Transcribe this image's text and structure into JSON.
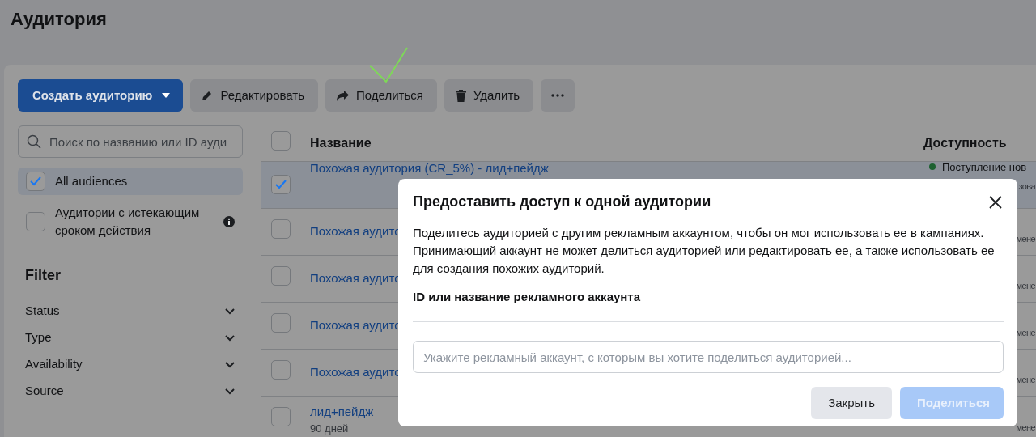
{
  "page": {
    "title": "Аудитория"
  },
  "toolbar": [
    {
      "kind": "create",
      "label": "Создать аудиторию"
    },
    {
      "kind": "edit",
      "label": "Редактировать"
    },
    {
      "kind": "share",
      "label": "Поделиться"
    },
    {
      "kind": "delete",
      "label": "Удалить"
    },
    {
      "kind": "more"
    }
  ],
  "sidebar": {
    "search": {
      "placeholder": "Поиск по названию или ID ауди"
    },
    "audience_sets": [
      {
        "label": "All audiences",
        "checked": true,
        "info": false
      },
      {
        "label": "Аудитории с истекающим сроком действия",
        "checked": false,
        "info": true
      }
    ],
    "filter": {
      "title": "Filter",
      "items": [
        {
          "label": "Status",
          "expanded": false
        },
        {
          "label": "Type",
          "expanded": false
        },
        {
          "label": "Availability",
          "expanded": false
        },
        {
          "label": "Source",
          "expanded": false
        }
      ]
    }
  },
  "table": {
    "select_all": {
      "checked": false
    },
    "columns": [
      "Название",
      "Доступность"
    ],
    "rows": [
      {
        "name": "Похожая аудитория (CR_5%) - лид+пейдж",
        "checked": true,
        "availability": "Поступление нов",
        "color": "#1d6130",
        "availability_detail": "зова"
      },
      {
        "name": "Похожая аудито",
        "checked": false,
        "availability_detail": "мене"
      },
      {
        "name": "Похожая аудито",
        "checked": false,
        "availability_detail": "мене"
      },
      {
        "name": "Похожая аудито",
        "checked": false,
        "availability_detail": "мене"
      },
      {
        "name": "Похожая аудито",
        "checked": false,
        "availability_detail": "мене"
      },
      {
        "name": "лид+пейдж",
        "subtitle": "90 дней",
        "checked": false,
        "availability_detail": "мене"
      }
    ]
  },
  "dialog": {
    "title": "Предоставить доступ к одной аудитории",
    "description": "Поделитесь аудиторией с другим рекламным аккаунтом, чтобы он мог использовать ее в кампаниях. Принимающий аккаунт не может делиться аудиторией или редактировать ее, а также использовать ее для создания похожих аудиторий.",
    "field_label": "ID или название рекламного аккаунта",
    "field": {
      "placeholder": "Укажите рекламный аккаунт, с которым вы хотите поделиться аудиторией..."
    },
    "buttons": [
      {
        "kind": "secondary",
        "label": "Закрыть",
        "disabled": false
      },
      {
        "kind": "primary",
        "label": "Поделиться",
        "disabled": true
      }
    ]
  }
}
